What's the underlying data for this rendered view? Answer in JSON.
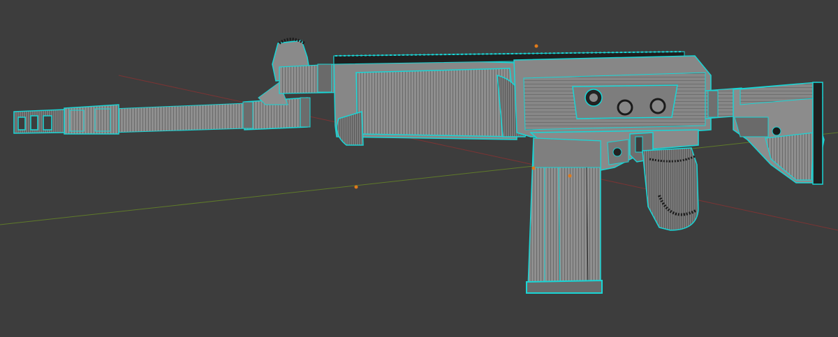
{
  "viewport": {
    "background": "#3d3d3d",
    "x_axis_color": "#8a3a3a",
    "y_axis_color": "#6e8a2e",
    "origin_marker_color": "#e07a1a",
    "edge_highlight_color": "#19d6d6",
    "wire_color": "#1a1a1a",
    "mesh_fill": "#8f8f8f",
    "mesh_fill_dark": "#6f6f6f",
    "mesh_fill_light": "#a5a5a5"
  },
  "model": {
    "icon": "rifle-mesh-icon",
    "edit_mode": "edge-select"
  }
}
